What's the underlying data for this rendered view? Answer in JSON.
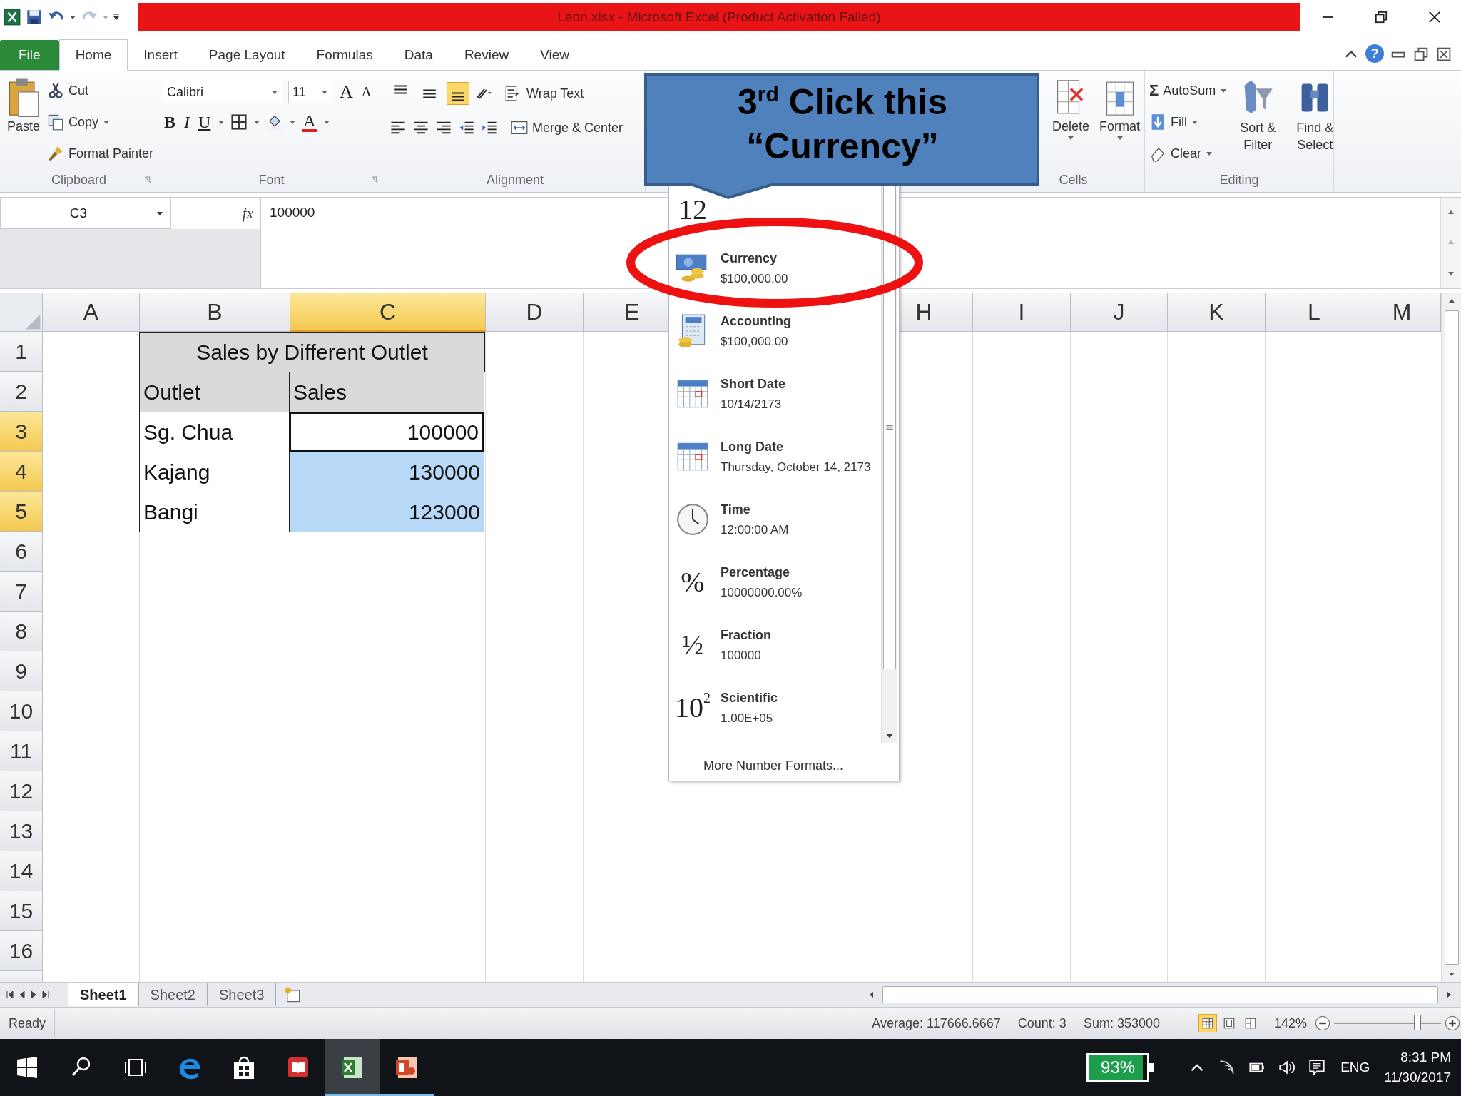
{
  "window": {
    "title": "Leon.xlsx - Microsoft Excel (Product Activation Failed)"
  },
  "ribbon_tabs": [
    {
      "label": "File",
      "kind": "file",
      "selected": false
    },
    {
      "label": "Home",
      "kind": "tab",
      "selected": true
    },
    {
      "label": "Insert",
      "kind": "tab",
      "selected": false
    },
    {
      "label": "Page Layout",
      "kind": "tab",
      "selected": false
    },
    {
      "label": "Formulas",
      "kind": "tab",
      "selected": false
    },
    {
      "label": "Data",
      "kind": "tab",
      "selected": false
    },
    {
      "label": "Review",
      "kind": "tab",
      "selected": false
    },
    {
      "label": "View",
      "kind": "tab",
      "selected": false
    }
  ],
  "help": "?",
  "clipboard": {
    "paste": "Paste",
    "cut": "Cut",
    "copy": "Copy",
    "format_painter": "Format Painter",
    "group": "Clipboard"
  },
  "font": {
    "name": "Calibri",
    "size": "11",
    "grow": "A",
    "shrink": "A",
    "bold": "B",
    "italic": "I",
    "underline": "U",
    "font_color": "A",
    "group": "Font"
  },
  "alignment": {
    "align_buttons": [
      {
        "kind": "top",
        "selected": false
      },
      {
        "kind": "middle",
        "selected": false
      },
      {
        "kind": "bottom",
        "selected": true
      }
    ],
    "wrap": "Wrap Text",
    "merge": "Merge & Center",
    "group": "Alignment"
  },
  "cells": {
    "delete": "Delete",
    "format": "Format",
    "group": "Cells"
  },
  "editing": {
    "sigma": "Σ",
    "autosum": "AutoSum",
    "fill": "Fill",
    "clear": "Clear",
    "sort": "Sort & Filter",
    "find": "Find & Select",
    "group": "Editing"
  },
  "formula_bar": {
    "name_box": "C3",
    "fx": "fx",
    "value": "100000"
  },
  "columns": [
    {
      "label": "A",
      "selected": false
    },
    {
      "label": "B",
      "selected": false
    },
    {
      "label": "C",
      "selected": true
    },
    {
      "label": "D",
      "selected": false
    },
    {
      "label": "E",
      "selected": false
    },
    {
      "label": "H",
      "selected": false
    },
    {
      "label": "I",
      "selected": false
    },
    {
      "label": "J",
      "selected": false
    },
    {
      "label": "K",
      "selected": false
    },
    {
      "label": "L",
      "selected": false
    },
    {
      "label": "M",
      "selected": false
    }
  ],
  "rows": [
    {
      "label": "1",
      "selected": false,
      "cells": [
        {
          "kind": "title",
          "text": "Sales by Different Outlet"
        }
      ]
    },
    {
      "label": "2",
      "selected": false,
      "cells": [
        {
          "kind": "header",
          "text": "Outlet"
        },
        {
          "kind": "header",
          "text": "Sales"
        }
      ]
    },
    {
      "label": "3",
      "selected": true,
      "cells": [
        {
          "kind": "text",
          "text": "Sg. Chua"
        },
        {
          "kind": "number",
          "text": "100000",
          "selected": false,
          "active": true
        }
      ]
    },
    {
      "label": "4",
      "selected": true,
      "cells": [
        {
          "kind": "text",
          "text": "Kajang"
        },
        {
          "kind": "number",
          "text": "130000",
          "selected": true,
          "active": false
        }
      ]
    },
    {
      "label": "5",
      "selected": true,
      "cells": [
        {
          "kind": "text",
          "text": "Bangi"
        },
        {
          "kind": "number",
          "text": "123000",
          "selected": true,
          "active": false
        }
      ]
    },
    {
      "label": "6",
      "selected": false
    },
    {
      "label": "7",
      "selected": false
    },
    {
      "label": "8",
      "selected": false
    },
    {
      "label": "9",
      "selected": false
    },
    {
      "label": "10",
      "selected": false
    },
    {
      "label": "11",
      "selected": false
    },
    {
      "label": "12",
      "selected": false
    },
    {
      "label": "13",
      "selected": false
    },
    {
      "label": "14",
      "selected": false
    },
    {
      "label": "15",
      "selected": false
    },
    {
      "label": "16",
      "selected": false
    }
  ],
  "number_formats": {
    "items": [
      {
        "kind": "number",
        "glyph": "12"
      },
      {
        "kind": "currency",
        "label": "Currency",
        "example": "$100,000.00"
      },
      {
        "kind": "accounting",
        "label": "Accounting",
        "example": " $100,000.00"
      },
      {
        "kind": "date",
        "label": "Short Date",
        "example": "10/14/2173"
      },
      {
        "kind": "date",
        "label": "Long Date",
        "example": "Thursday, October 14, 2173"
      },
      {
        "kind": "time",
        "label": "Time",
        "example": "12:00:00 AM"
      },
      {
        "kind": "glyph",
        "glyph": "%",
        "label": "Percentage",
        "example": "10000000.00%"
      },
      {
        "kind": "glyph",
        "glyph": "½",
        "label": "Fraction",
        "example": "100000"
      },
      {
        "kind": "glyph",
        "glyph": "10$^{2}$",
        "label": "Scientific",
        "example": "1.00E+05"
      }
    ],
    "more": "More Number Formats..."
  },
  "callout": {
    "text": "3$^{rd}$ Click this “Currency”"
  },
  "sheet_tabs": [
    {
      "label": "Sheet1",
      "selected": true
    },
    {
      "label": "Sheet2",
      "selected": false
    },
    {
      "label": "Sheet3",
      "selected": false
    }
  ],
  "status_bar": {
    "ready": "Ready",
    "average": "Average: 117666.6667",
    "count": "Count: 3",
    "sum": "Sum: 353000",
    "views": [
      {
        "kind": "normal",
        "selected": true
      },
      {
        "kind": "layout",
        "selected": false
      },
      {
        "kind": "break",
        "selected": false
      }
    ],
    "zoom": "142%",
    "zoom_slider": {
      "level": 0.78
    }
  },
  "taskbar": {
    "apps": [
      {
        "kind": "start",
        "selected": false
      },
      {
        "kind": "search",
        "selected": false
      },
      {
        "kind": "taskview",
        "selected": false
      },
      {
        "kind": "browser",
        "selected": false
      },
      {
        "kind": "store",
        "selected": false
      },
      {
        "kind": "reader",
        "selected": false
      },
      {
        "kind": "excel",
        "selected": true
      },
      {
        "kind": "powerpoint",
        "selected": false
      }
    ],
    "battery": {
      "text": "93%",
      "level": 0.93
    },
    "language": "ENG",
    "time": "8:31 PM",
    "date": "11/30/2017"
  }
}
